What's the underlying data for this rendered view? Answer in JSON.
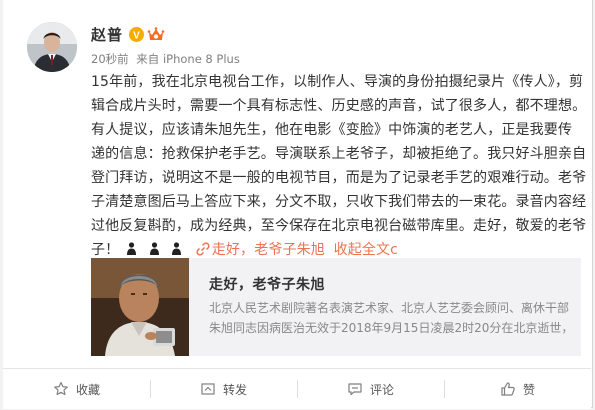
{
  "user": {
    "name": "赵普",
    "verified_mark": "V",
    "vip_badge": "vip-crown-icon"
  },
  "meta": {
    "time": "20秒前",
    "from_label": "来自",
    "device": "iPhone 8 Plus"
  },
  "post": {
    "lines": [
      "15年前，我在北京电视台工作，以制作人、导演的身份拍摄纪录片《传人》，剪",
      "辑合成片头时，需要一个具有标志性、历史感的声音，试了很多人，都不理想。",
      "有人提议，应该请朱旭先生，他在电影《变脸》中饰演的老艺人，正是我要传",
      "递的信息：抢救保护老手艺。导演联系上老爷子，却被拒绝了。我只好斗胆亲自",
      "登门拜访，说明这不是一般的电视节目，而是为了记录老手艺的艰难行动。老爷",
      "子清楚意图后马上答应下来，分文不取，只收下我们带去的一束花。录音内容经",
      "过他反复斟酌，成为经典，至今保存在北京电视台磁带库里。走好，敬爱的老爷"
    ],
    "last_line_start": "子！",
    "link_text": "走好，老爷子朱旭",
    "collapse_text": "收起全文",
    "collapse_suffix": "c"
  },
  "article": {
    "title": "走好，老爷子朱旭",
    "desc_lines": [
      "北京人民艺术剧院著名表演艺术家、北京人艺艺委会顾问、离休干部",
      "朱旭同志因病医治无效于2018年9月15日凌晨2时20分在北京逝世，"
    ]
  },
  "actions": {
    "favorite": "收藏",
    "repost": "转发",
    "comment": "评论",
    "like": "赞"
  },
  "colors": {
    "link": "#eb7350",
    "verified": "#f6ab00",
    "text": "#333333",
    "meta": "#808080"
  }
}
